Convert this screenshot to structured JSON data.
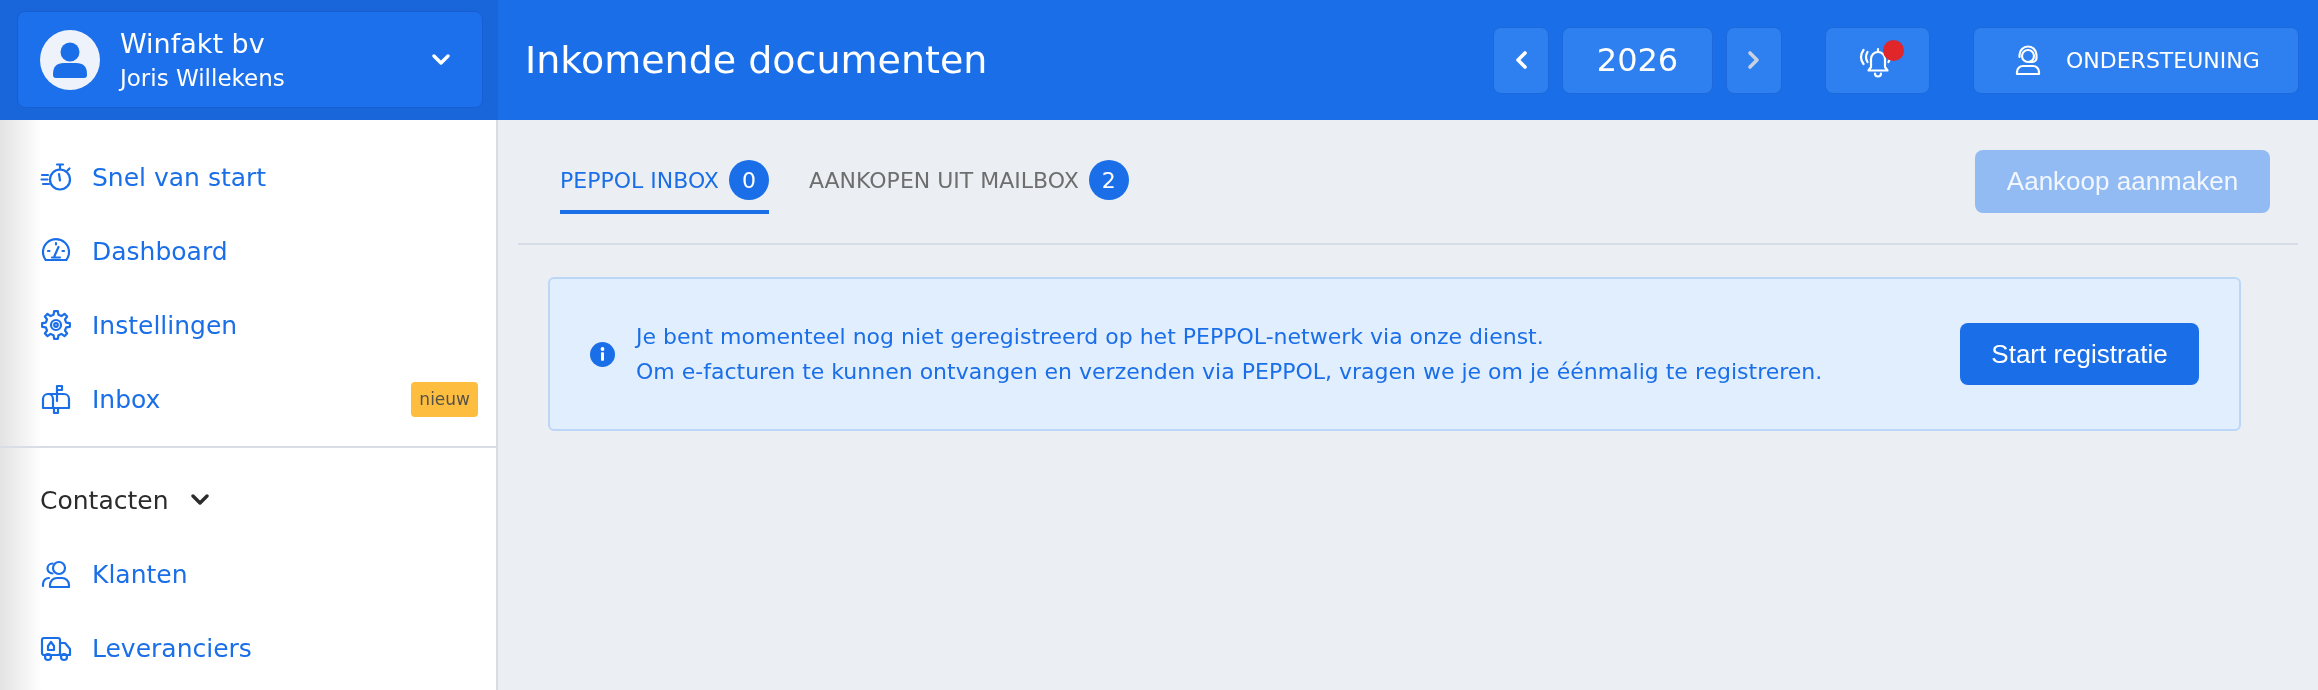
{
  "account": {
    "company": "Winfakt bv",
    "user": "Joris Willekens"
  },
  "sidebar": {
    "sections": [
      {
        "items": [
          {
            "label": "Snel van start"
          },
          {
            "label": "Dashboard"
          },
          {
            "label": "Instellingen"
          },
          {
            "label": "Inbox",
            "badge": "nieuw"
          }
        ]
      },
      {
        "title": "Contacten",
        "expanded": true,
        "items": [
          {
            "label": "Klanten"
          },
          {
            "label": "Leveranciers"
          }
        ]
      }
    ]
  },
  "header": {
    "title": "Inkomende documenten",
    "year_nav": {
      "year": "2026",
      "previous": {
        "disabled": false
      },
      "next": {
        "disabled": true
      }
    },
    "notifications": {
      "unread": true
    },
    "support_button": "ONDERSTEUNING"
  },
  "tabs": [
    {
      "label": "PEPPOL INBOX",
      "count": "0",
      "selected": true
    },
    {
      "label": "AANKOPEN UIT MAILBOX",
      "count": "2",
      "selected": false
    }
  ],
  "create_button": {
    "label": "Aankoop aanmaken",
    "disabled": true
  },
  "notice": {
    "lines": [
      "Je bent momenteel nog niet geregistreerd op het PEPPOL-netwerk via onze dienst.",
      "Om e-facturen te kunnen ontvangen en verzenden via PEPPOL, vragen we je om je éénmalig te registreren."
    ],
    "button": "Start registratie"
  }
}
